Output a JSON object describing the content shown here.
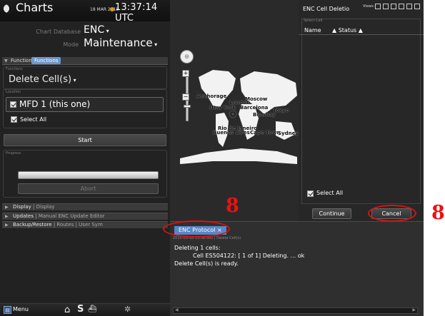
{
  "header": {
    "app_title": "Charts",
    "date": "18 MAR 2015",
    "time": "13:37:14 UTC"
  },
  "settings": {
    "chart_database_label": "Chart Database",
    "chart_database_value": "ENC",
    "mode_label": "Mode",
    "mode_value": "Maintenance"
  },
  "functions_panel": {
    "tab_inactive": "Functions",
    "tab_active": "Functions",
    "functions_caption": "Functions",
    "function_value": "Delete Cell(s)",
    "location_caption": "Location",
    "location_option": "MFD 1 (this one)",
    "select_all_label": "Select All",
    "start_label": "Start",
    "progress_caption": "Progress",
    "progress_fraction": 1.0,
    "abort_label": "Abort"
  },
  "sections": [
    {
      "title": "Display",
      "sub": "| Display"
    },
    {
      "title": "Updates",
      "sub": "| Manual ENC Update Editor"
    },
    {
      "title": "Backup/Restore",
      "sub": "| Routes | User Sym"
    }
  ],
  "bottom_bar": {
    "menu_label": "Menu",
    "s_label": "S"
  },
  "map": {
    "cities": [
      "Anchorage",
      "London",
      "Moscow",
      "New York",
      "Barcelona",
      "Tokyo",
      "Bombay",
      "Rio de Janeiro",
      "Buenos Aires",
      "Cape Town",
      "Sydney"
    ]
  },
  "enc_panel": {
    "title": "ENC Cell Deletio",
    "views_label": "Views:",
    "select_cell_caption": "Select Cell",
    "col_name": "Name",
    "col_status": "▲ Status ▲",
    "select_all_label": "Select All",
    "continue_label": "Continue",
    "cancel_label": "Cancel"
  },
  "protocol": {
    "tab_label": "ENC Protocol",
    "tab_close": "×",
    "subheader": "2015-03-18 13:36:582 | Delete Cell(s)",
    "lines": [
      "Deleting 1 cells:",
      "Cell ES504122: [ 1 of  1] Deleting. ... ok",
      "Delete Cell(s) is ready."
    ]
  },
  "annotations": {
    "number_left": "8",
    "number_right": "8",
    "color": "#dd1111"
  }
}
